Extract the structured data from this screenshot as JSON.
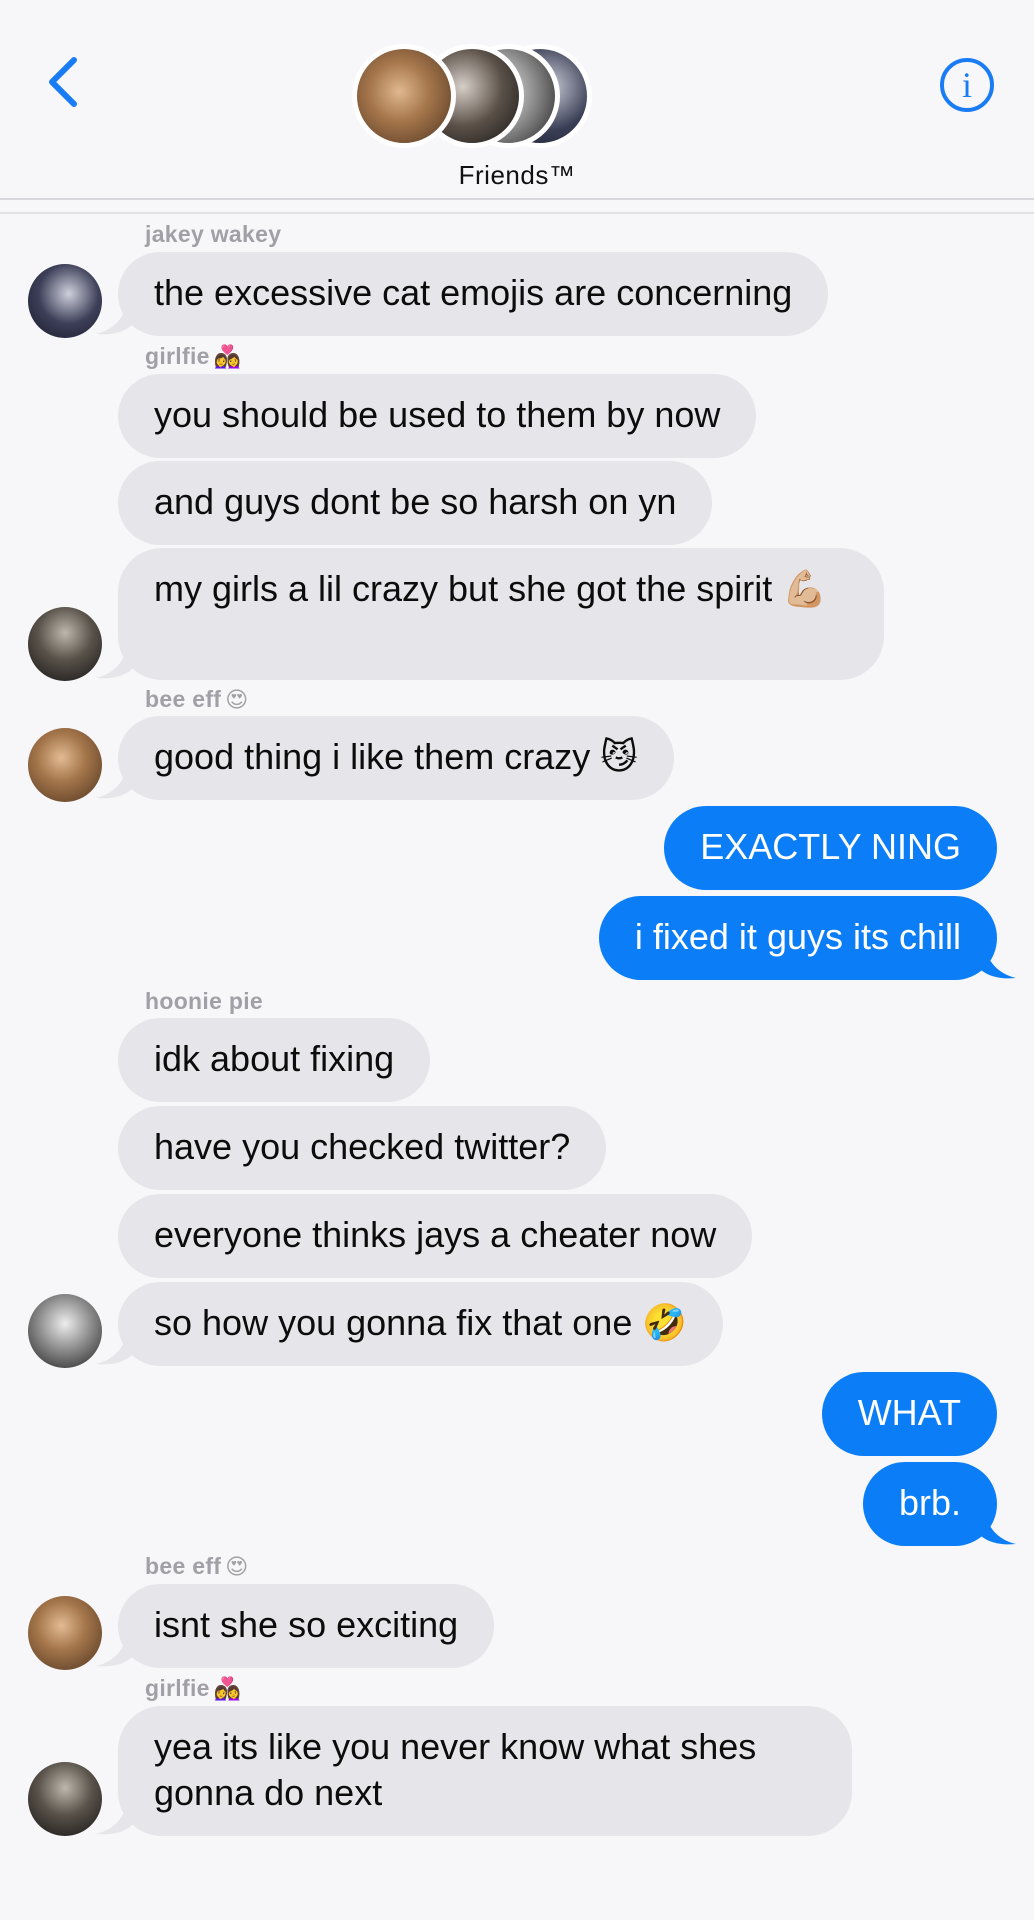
{
  "header": {
    "group_name": "Friends™",
    "back_icon": "chevron-left-icon",
    "info_icon": "info-circle-icon",
    "info_glyph": "i",
    "accent": "#1a7cf5"
  },
  "colors": {
    "incoming_bubble": "#e6e5ea",
    "outgoing_bubble": "#0b7ef7",
    "background": "#f7f7f9"
  },
  "messages": [
    {
      "sender": "jakey wakey",
      "sender_emoji": "",
      "text": "the excessive cat emojis are concerning"
    },
    {
      "sender": "girlfie",
      "sender_emoji": "👩‍❤️‍👩",
      "text": "you should be used to them by now"
    },
    {
      "text": "and guys dont be so harsh on yn"
    },
    {
      "text": "my girls a lil crazy but she got the spirit 💪🏼"
    },
    {
      "sender": "bee eff",
      "sender_emoji": "😍",
      "text": "good thing i like them crazy 😼"
    },
    {
      "text": "EXACTLY NING"
    },
    {
      "text": "i fixed it guys its chill"
    },
    {
      "sender": "hoonie pie",
      "sender_emoji": "",
      "text": "idk about fixing"
    },
    {
      "text": "have you checked twitter?"
    },
    {
      "text": "everyone thinks jays a cheater now"
    },
    {
      "text": "so how you gonna fix that one 🤣"
    },
    {
      "text": "WHAT"
    },
    {
      "text": "brb."
    },
    {
      "sender": "bee eff",
      "sender_emoji": "😍",
      "text": "isnt she so exciting"
    },
    {
      "sender": "girlfie",
      "sender_emoji": "👩‍❤️‍👩",
      "text": "yea its like you never know what shes gonna do next"
    }
  ]
}
